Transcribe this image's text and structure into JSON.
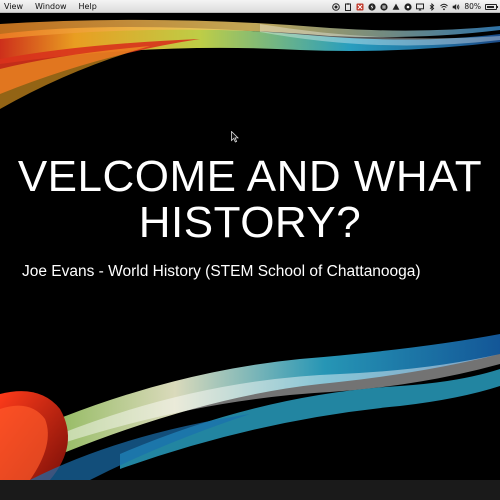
{
  "menubar": {
    "items": [
      "View",
      "Window",
      "Help"
    ],
    "status_icons": [
      "screen-record-icon",
      "clipboard-icon",
      "vpn-icon",
      "flash-icon",
      "pause-icon",
      "drive-icon",
      "eye-icon",
      "cast-icon",
      "bluetooth-icon",
      "wifi-icon",
      "volume-icon"
    ],
    "battery_percent": "80%",
    "battery_level": 0.8
  },
  "slide": {
    "title": "VELCOME AND WHAT",
    "title_line2": "HISTORY?",
    "subtitle": "Joe Evans -  World History (STEM School of Chattanooga)",
    "background_color": "#000000",
    "accent_colors": [
      "#d8321c",
      "#f5a623",
      "#2aa6c9",
      "#c8d84a"
    ]
  }
}
